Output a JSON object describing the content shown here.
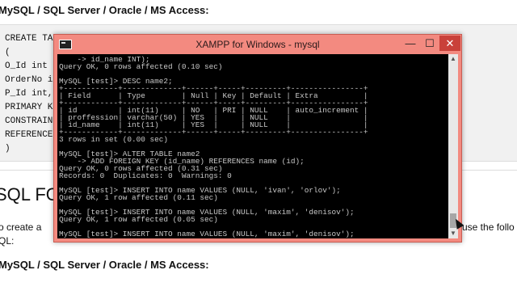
{
  "page": {
    "heading_top": "MySQL / SQL Server / Oracle / MS Access:",
    "code_lines": [
      "CREATE TA",
      "(",
      "O_Id int",
      "OrderNo i",
      "P_Id int,",
      "PRIMARY K",
      "CONSTRAIN",
      "REFERENCE",
      ")"
    ],
    "section_title": "SQL FO",
    "para_left": "o create a",
    "para_right": "use the follo",
    "para_line2": "QL:",
    "heading_bottom": "MySQL / SQL Server / Oracle / MS Access:"
  },
  "window": {
    "title": "XAMPP for Windows - mysql",
    "minimize": "—",
    "maximize": "☐",
    "close": "✕"
  },
  "console": {
    "lines": [
      "    -> id_name INT);",
      "Query OK, 0 rows affected (0.10 sec)",
      "",
      "MySQL [test]> DESC name2;",
      "+------------+-------------+------+-----+---------+----------------+",
      "| Field      | Type        | Null | Key | Default | Extra          |",
      "+------------+-------------+------+-----+---------+----------------+",
      "| id         | int(11)     | NO   | PRI | NULL    | auto_increment |",
      "| proffession| varchar(50) | YES  |     | NULL    |                |",
      "| id_name    | int(11)     | YES  |     | NULL    |                |",
      "+------------+-------------+------+-----+---------+----------------+",
      "3 rows in set (0.00 sec)",
      "",
      "MySQL [test]> ALTER TABLE name2",
      "    -> ADD FOREIGN KEY (id_name) REFERENCES name (id);",
      "Query OK, 0 rows affected (0.31 sec)",
      "Records: 0  Duplicates: 0  Warnings: 0",
      "",
      "MySQL [test]> INSERT INTO name VALUES (NULL, 'ivan', 'orlov');",
      "Query OK, 1 row affected (0.11 sec)",
      "",
      "MySQL [test]> INSERT INTO name VALUES (NULL, 'maxim', 'denisov');",
      "Query OK, 1 row affected (0.05 sec)",
      "",
      "MySQL [test]> INSERT INTO name VALUES (NULL, 'maxim', 'denisov');"
    ]
  },
  "scrollbar": {
    "up": "▲",
    "down": "▼"
  }
}
